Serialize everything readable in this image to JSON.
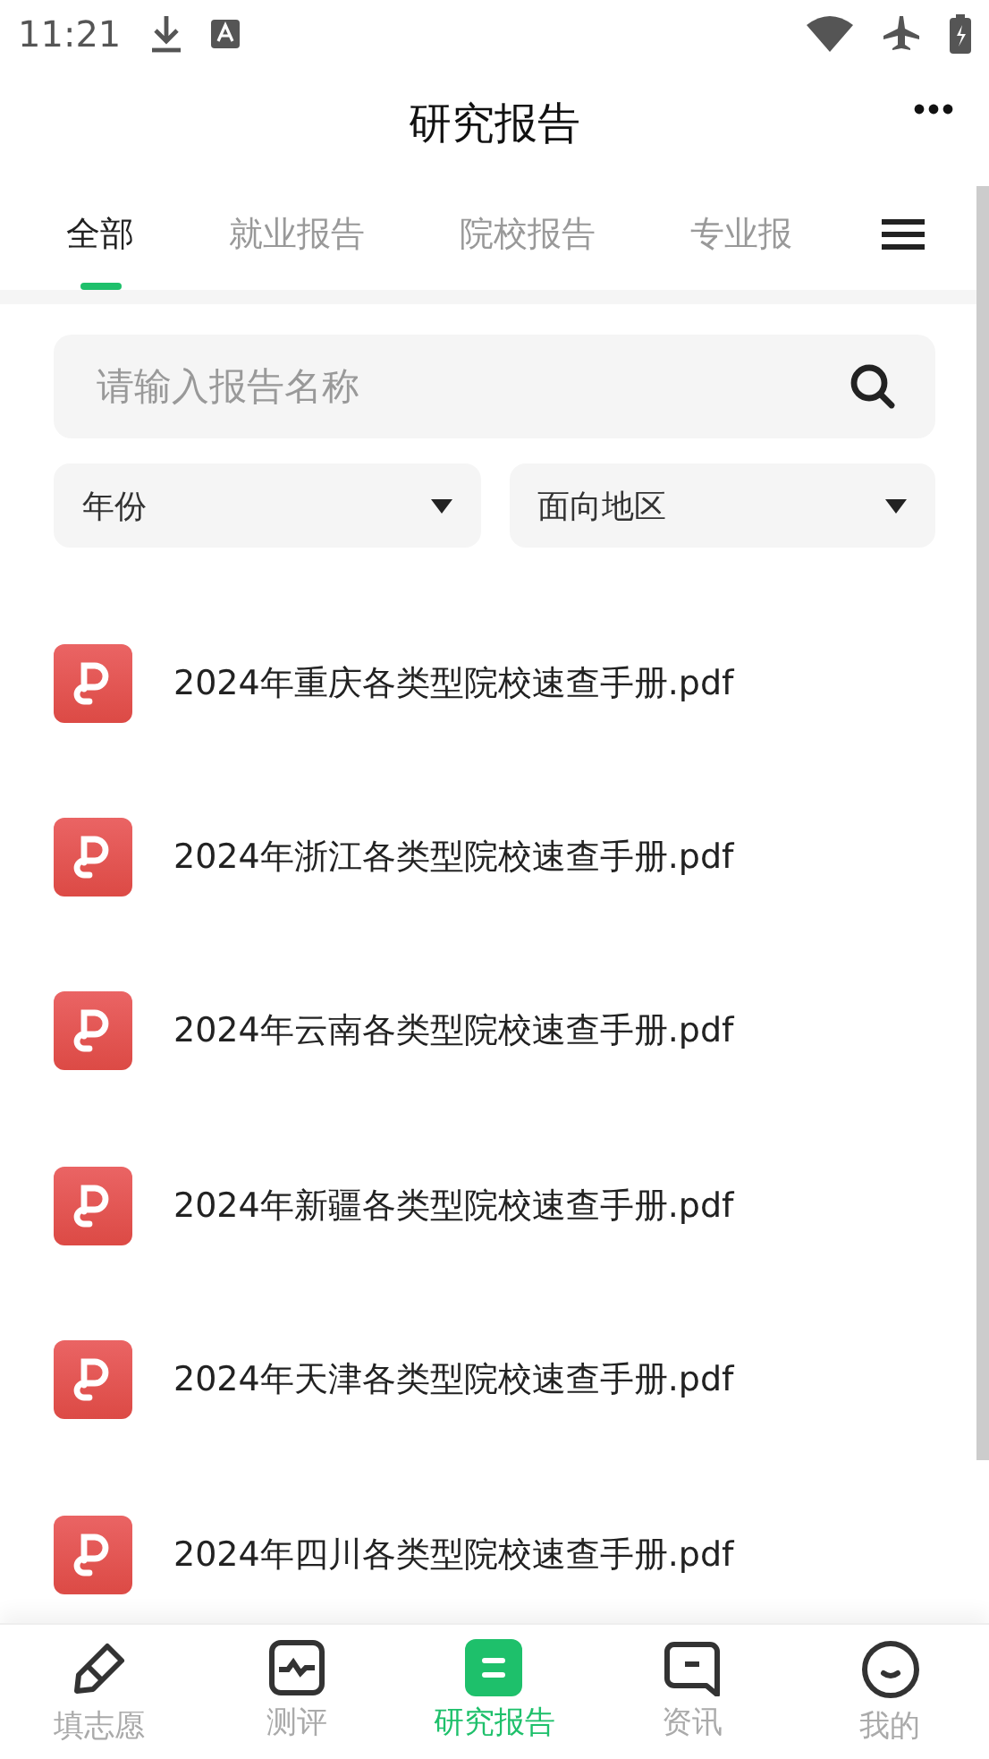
{
  "status_bar": {
    "time": "11:21"
  },
  "header": {
    "title": "研究报告"
  },
  "tabs": [
    {
      "label": "全部",
      "selected": true
    },
    {
      "label": "就业报告",
      "selected": false
    },
    {
      "label": "院校报告",
      "selected": false
    },
    {
      "label": "专业报",
      "selected": false
    }
  ],
  "search": {
    "placeholder": "请输入报告名称"
  },
  "filters": [
    {
      "label": "年份"
    },
    {
      "label": "面向地区"
    }
  ],
  "reports": [
    {
      "name": "2024年重庆各类型院校速查手册.pdf"
    },
    {
      "name": "2024年浙江各类型院校速查手册.pdf"
    },
    {
      "name": "2024年云南各类型院校速查手册.pdf"
    },
    {
      "name": "2024年新疆各类型院校速查手册.pdf"
    },
    {
      "name": "2024年天津各类型院校速查手册.pdf"
    },
    {
      "name": "2024年四川各类型院校速查手册.pdf"
    }
  ],
  "bottom_nav": [
    {
      "label": "填志愿",
      "kind": "pencil",
      "selected": false
    },
    {
      "label": "测评",
      "kind": "chart",
      "selected": false
    },
    {
      "label": "研究报告",
      "kind": "report",
      "selected": true
    },
    {
      "label": "资讯",
      "kind": "chat",
      "selected": false
    },
    {
      "label": "我的",
      "kind": "smile",
      "selected": false
    }
  ]
}
